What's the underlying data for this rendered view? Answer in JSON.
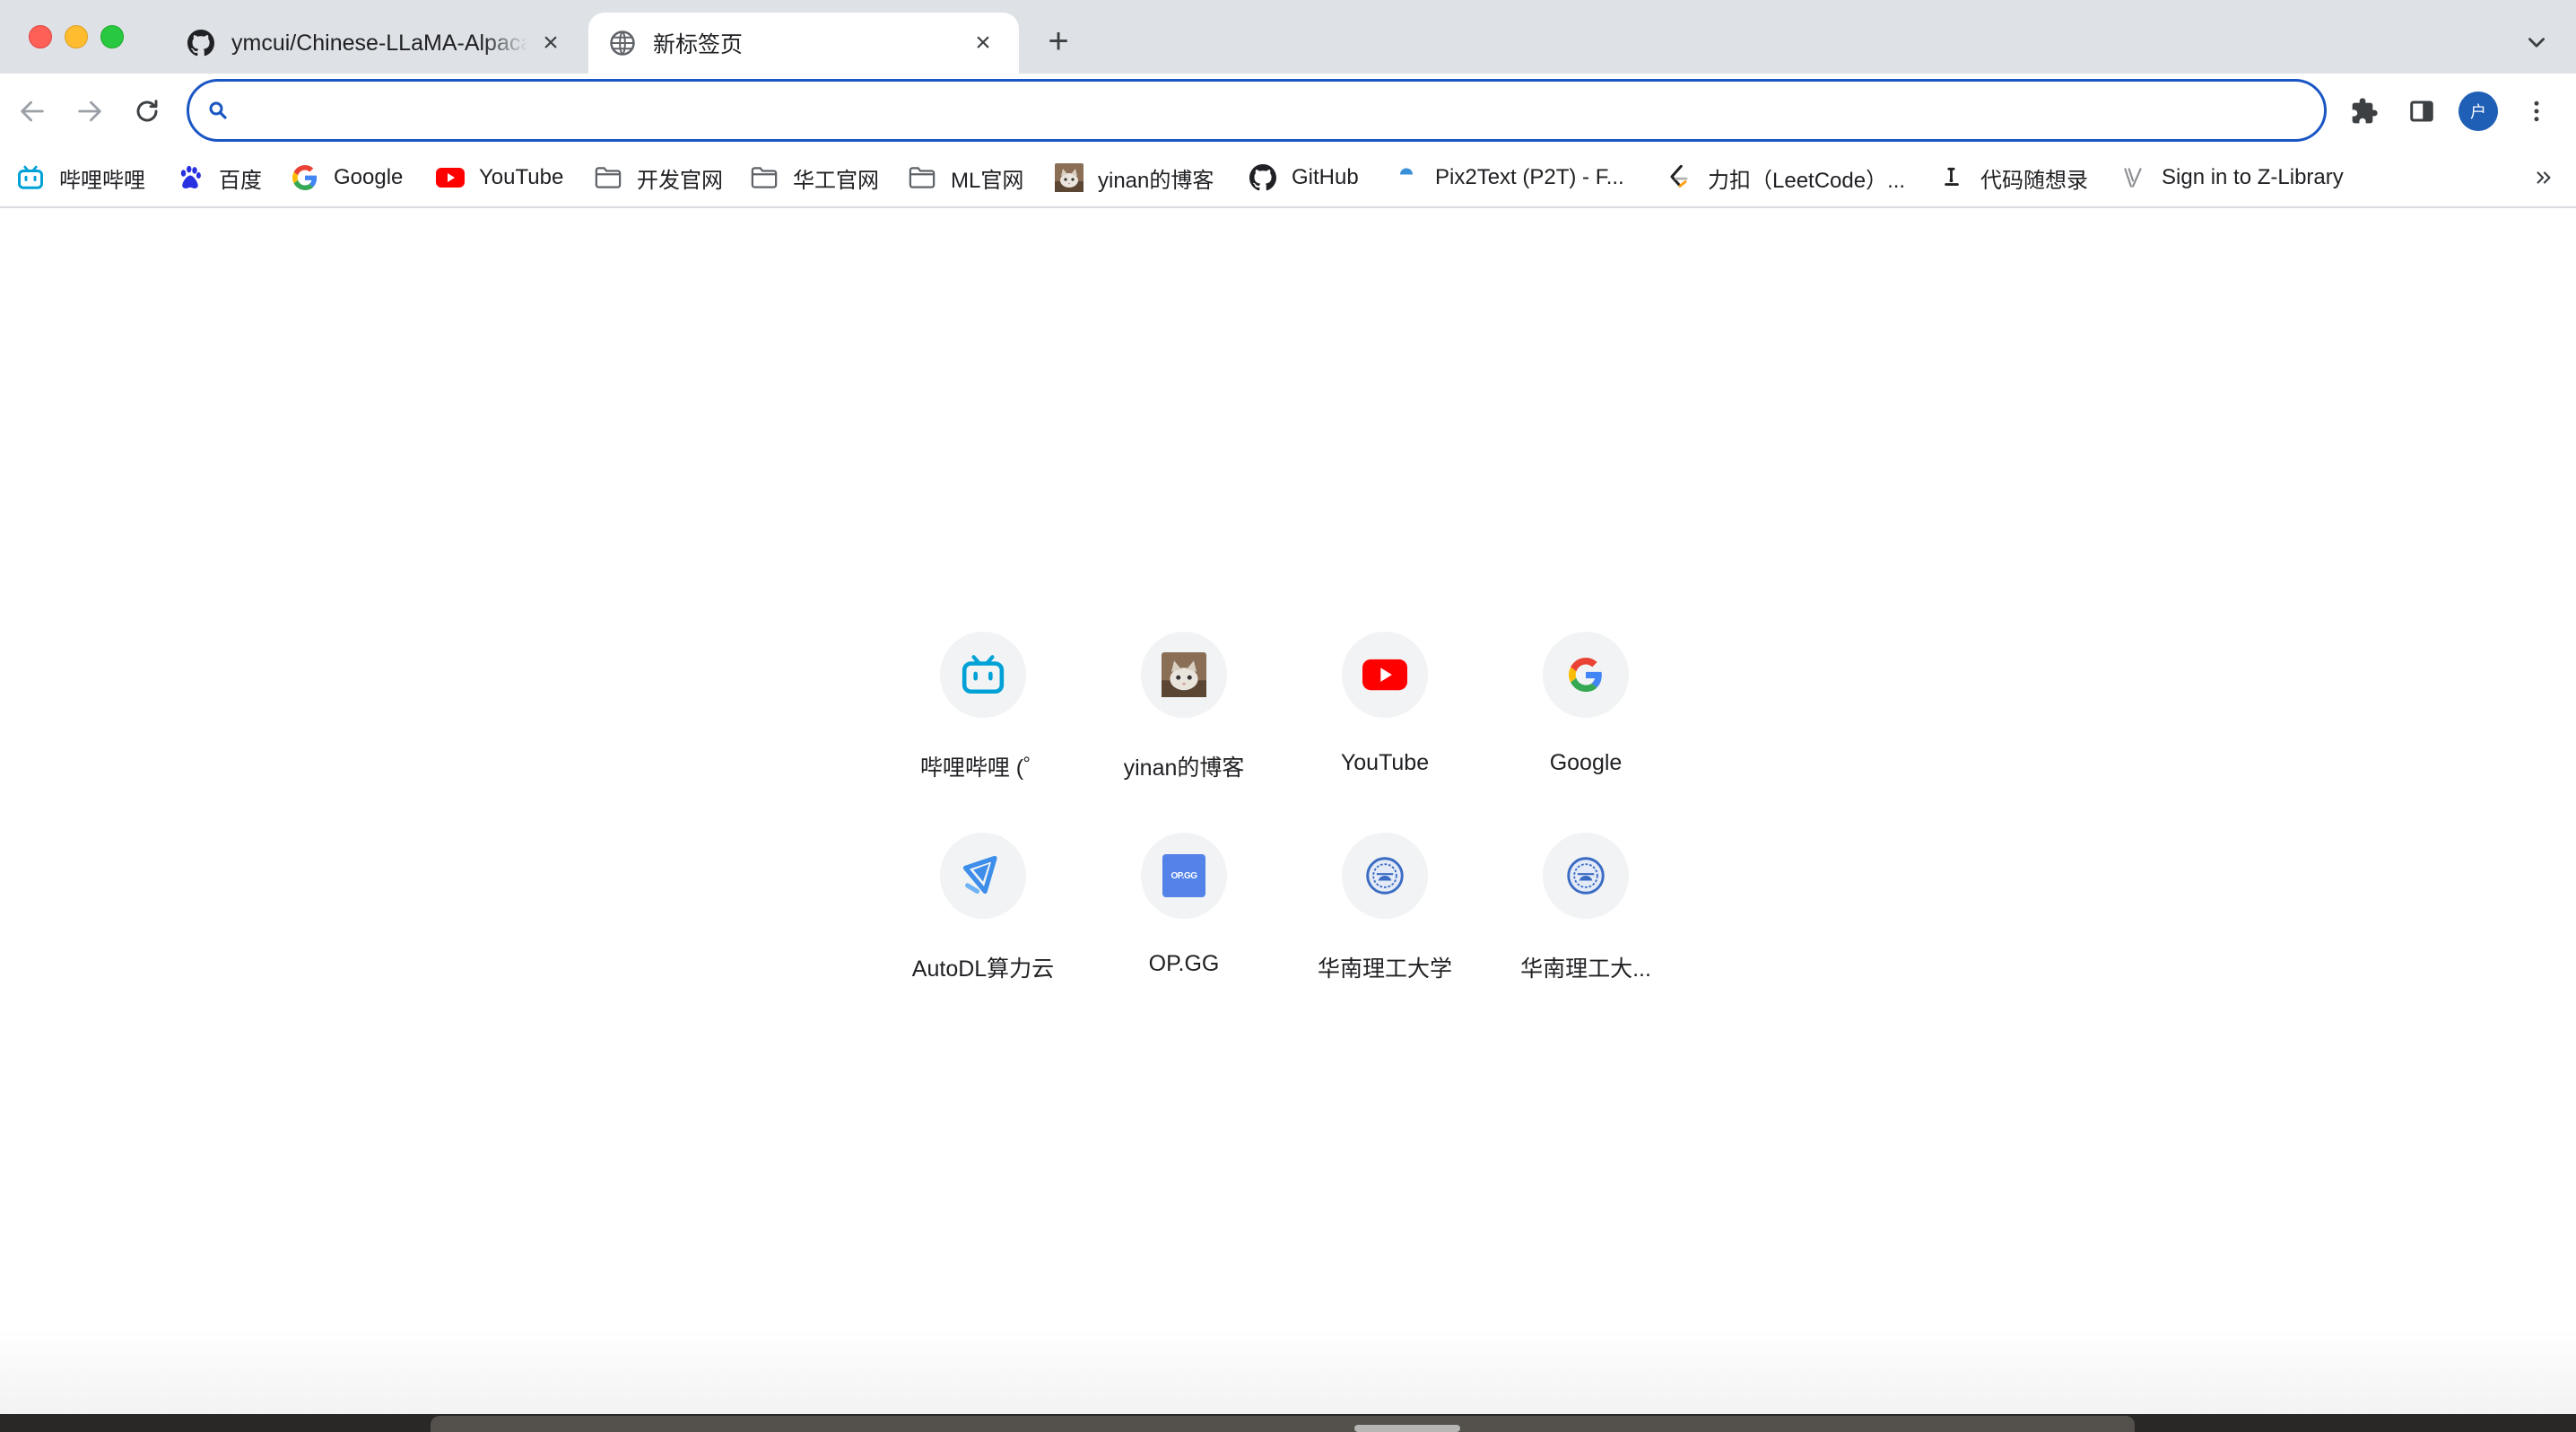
{
  "window": {
    "tabs": [
      {
        "title": "ymcui/Chinese-LLaMA-Alpaca",
        "favicon": "github-icon",
        "active": false
      },
      {
        "title": "新标签页",
        "favicon": "globe-icon",
        "active": true
      }
    ]
  },
  "toolbar": {
    "omnibox_value": "",
    "profile_initial": "户"
  },
  "bookmarks": [
    {
      "label": "哔哩哔哩",
      "icon": "bilibili-icon"
    },
    {
      "label": "百度",
      "icon": "baidu-icon"
    },
    {
      "label": "Google",
      "icon": "google-icon"
    },
    {
      "label": "YouTube",
      "icon": "youtube-icon"
    },
    {
      "label": "开发官网",
      "icon": "folder-icon"
    },
    {
      "label": "华工官网",
      "icon": "folder-icon"
    },
    {
      "label": "ML官网",
      "icon": "folder-icon"
    },
    {
      "label": "yinan的博客",
      "icon": "cat-photo-icon"
    },
    {
      "label": "GitHub",
      "icon": "github-icon"
    },
    {
      "label": "Pix2Text (P2T) - F...",
      "icon": "pix2text-icon"
    },
    {
      "label": "力扣（LeetCode）...",
      "icon": "leetcode-icon"
    },
    {
      "label": "代码随想录",
      "icon": "code-icon"
    },
    {
      "label": "Sign in to Z-Library",
      "icon": "zlibrary-icon"
    }
  ],
  "shortcuts": [
    {
      "label": "哔哩哔哩 (゜",
      "icon": "bilibili-icon"
    },
    {
      "label": "yinan的博客",
      "icon": "cat-photo-icon"
    },
    {
      "label": "YouTube",
      "icon": "youtube-icon"
    },
    {
      "label": "Google",
      "icon": "google-icon"
    },
    {
      "label": "AutoDL算力云",
      "icon": "autodl-icon"
    },
    {
      "label": "OP.GG",
      "icon": "opgg-icon"
    },
    {
      "label": "华南理工大学",
      "icon": "scut-emblem-icon"
    },
    {
      "label": "华南理工大...",
      "icon": "scut-emblem-icon"
    }
  ],
  "opgg_badge": "OP.GG",
  "colors": {
    "omnibox_border": "#1a56c4",
    "avatar": "#1f5fb5",
    "bilibili": "#00a1d6",
    "youtube": "#ff0000",
    "opgg": "#5383e8"
  }
}
